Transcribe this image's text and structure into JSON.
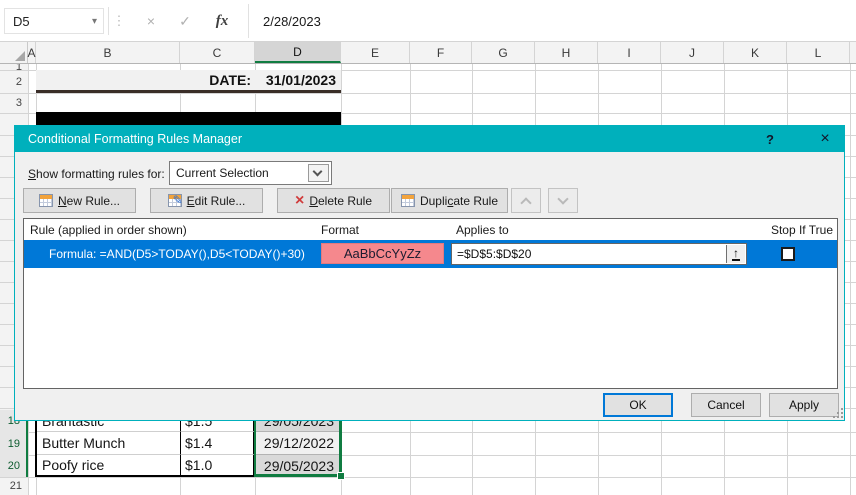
{
  "formula_bar": {
    "name_box": "D5",
    "namebox_arrow": "▾",
    "grip_dots": "⋮",
    "cancel_icon": "×",
    "enter_icon": "✓",
    "fx_icon": "fx",
    "formula": "2/28/2023"
  },
  "sheet": {
    "columns": [
      "A",
      "B",
      "C",
      "D",
      "E",
      "F",
      "G",
      "H",
      "I",
      "J",
      "K",
      "L"
    ],
    "row_numbers_top": [
      "1",
      "2",
      "3"
    ],
    "row_numbers_bottom": [
      "18",
      "19",
      "20",
      "21"
    ],
    "header_row": {
      "date_label": "DATE:",
      "date_value": "31/01/2023"
    },
    "products": [
      {
        "row": "18",
        "name": "Brantastic",
        "price": "$1.5",
        "date": "29/05/2023"
      },
      {
        "row": "19",
        "name": "Butter Munch",
        "price": "$1.4",
        "date": "29/12/2022"
      },
      {
        "row": "20",
        "name": "Poofy rice",
        "price": "$1.0",
        "date": "29/05/2023"
      }
    ]
  },
  "dialog": {
    "title": "Conditional Formatting Rules Manager",
    "help_icon": "?",
    "close_icon": "×",
    "show_rules": {
      "key": "S",
      "post": "how formatting rules for:"
    },
    "combo_value": "Current Selection",
    "toolbar": {
      "new": {
        "pre": "",
        "key": "N",
        "post": "ew Rule..."
      },
      "edit": {
        "pre": "",
        "key": "E",
        "post": "dit Rule..."
      },
      "delete": {
        "pre": "",
        "key": "D",
        "post": "elete Rule"
      },
      "duplicate": {
        "pre": "Dupli",
        "key": "c",
        "post": "ate Rule"
      }
    },
    "icons": {
      "pencil": "✎",
      "delete_x": "×",
      "range_picker": "↑"
    },
    "list": {
      "col_rule": "Rule (applied in order shown)",
      "col_format": "Format",
      "col_applies": "Applies to",
      "col_stop": "Stop If True",
      "rule": {
        "description": "Formula: =AND(D5>TODAY(),D5<TODAY()+30)",
        "format_preview": "AaBbCcYyZz",
        "applies_to": "=$D$5:$D$20"
      }
    },
    "buttons": {
      "ok": "OK",
      "cancel": "Cancel",
      "apply": "Apply"
    }
  },
  "colors": {
    "dialog_titlebar": "#00b0bc",
    "selected_rule_row": "#0078d7",
    "format_preview_fill": "#f5888d",
    "excel_green": "#107c41"
  }
}
